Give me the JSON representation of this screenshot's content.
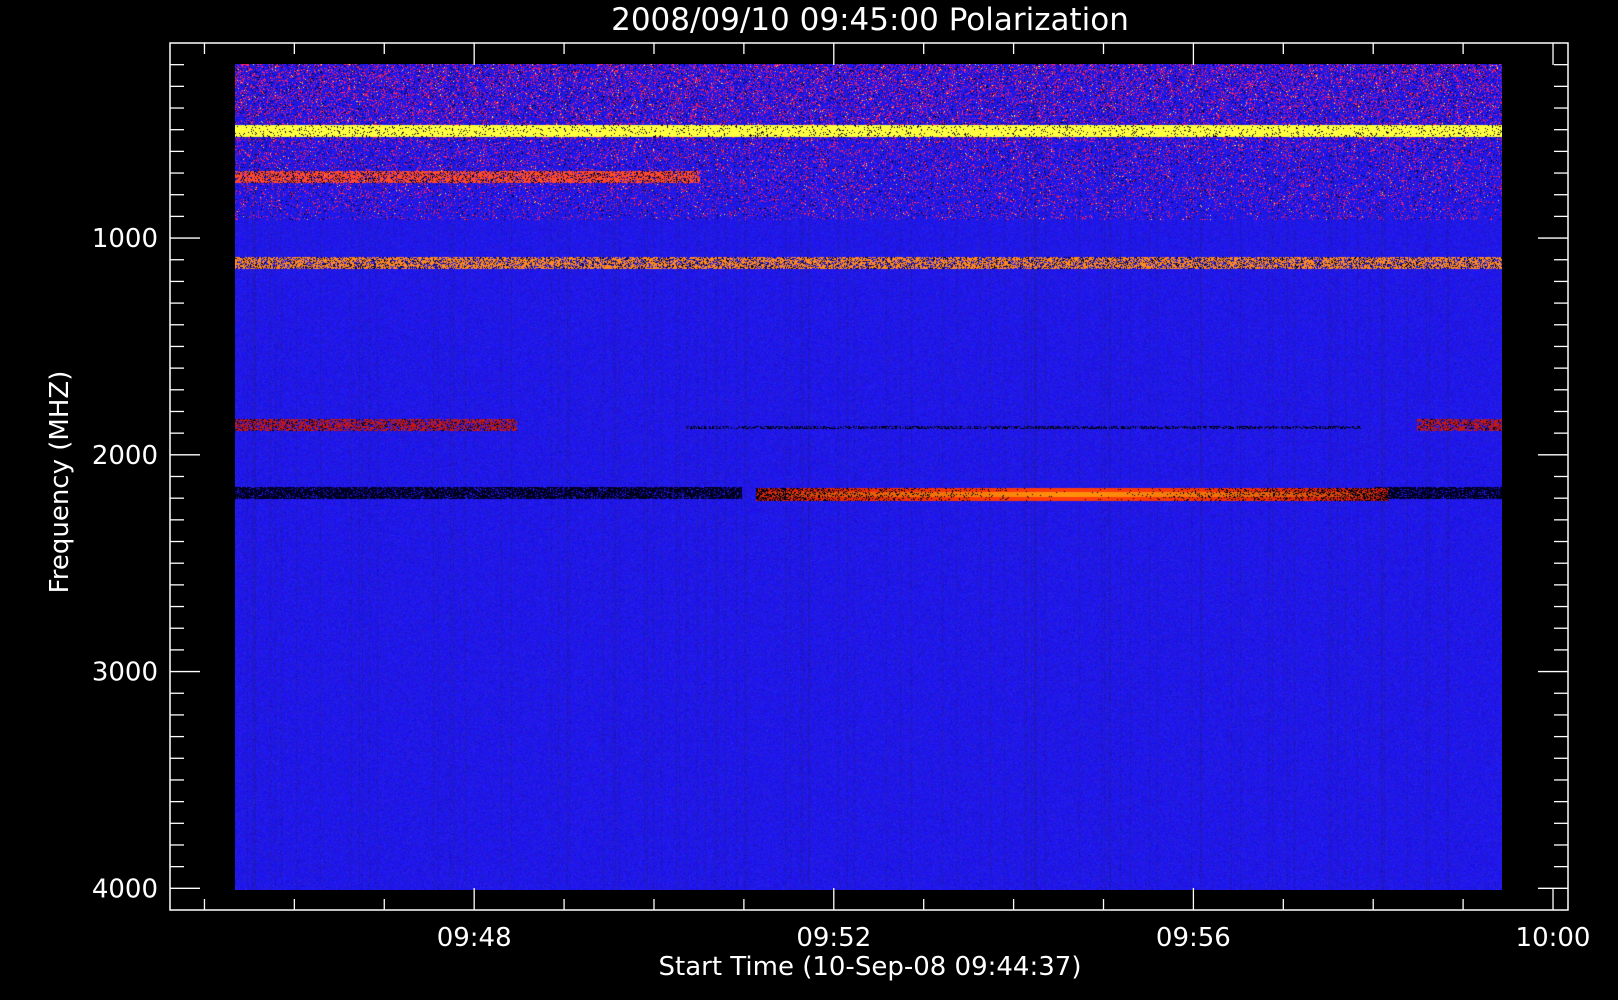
{
  "chart_data": {
    "type": "heatmap",
    "title": "2008/09/10 09:45:00 Polarization",
    "xlabel": "Start Time (10-Sep-08 09:44:37)",
    "ylabel": "Frequency (MHZ)",
    "x_range": [
      "09:44:37",
      "10:00:10"
    ],
    "x_ticks": [
      {
        "time": "09:48",
        "label": "09:48"
      },
      {
        "time": "09:52",
        "label": "09:52"
      },
      {
        "time": "09:56",
        "label": "09:56"
      },
      {
        "time": "10:00",
        "label": "10:00"
      }
    ],
    "x_data_range": [
      "09:45:00",
      "10:00:00"
    ],
    "y_range": [
      100,
      4100
    ],
    "y_inverted": true,
    "y_ticks": [
      {
        "value": 1000,
        "label": "1000"
      },
      {
        "value": 2000,
        "label": "2000"
      },
      {
        "value": 3000,
        "label": "3000"
      },
      {
        "value": 4000,
        "label": "4000"
      }
    ],
    "y_data_range": [
      200,
      4020
    ],
    "background_color": "#000000",
    "colormap": {
      "low": "#000000",
      "mid": "#0000ff",
      "high": "#ff2000",
      "peak": "#ffff60",
      "dominant": "#1a14f0"
    },
    "features": [
      {
        "kind": "noisy-band",
        "freq_from": 200,
        "freq_to": 920,
        "time_from": "09:45:00",
        "time_to": "10:00:00",
        "color": "#ff2a20",
        "intensity": 0.55
      },
      {
        "kind": "line",
        "freq": 510,
        "time_from": "09:45:00",
        "time_to": "10:00:00",
        "color": "#ffff40",
        "intensity": 0.9
      },
      {
        "kind": "line",
        "freq": 722,
        "time_from": "09:45:00",
        "time_to": "09:50:30",
        "color": "#ff4a2a",
        "intensity": 0.7
      },
      {
        "kind": "line",
        "freq": 1120,
        "time_from": "09:45:00",
        "time_to": "10:00:00",
        "color": "#ff8a20",
        "intensity": 0.6
      },
      {
        "kind": "line",
        "freq": 1870,
        "time_from": "09:45:00",
        "time_to": "09:48:20",
        "color": "#c01818",
        "intensity": 0.6
      },
      {
        "kind": "line",
        "freq": 1870,
        "time_from": "09:59:00",
        "time_to": "10:00:00",
        "color": "#c01818",
        "intensity": 0.6
      },
      {
        "kind": "dark-line",
        "freq": 1880,
        "time_from": "09:50:20",
        "time_to": "09:58:20",
        "color": "#000000",
        "intensity": 0.5
      },
      {
        "kind": "dark-band",
        "freq": 2185,
        "time_from": "09:45:00",
        "time_to": "09:51:00",
        "color": "#000010",
        "intensity": 0.8
      },
      {
        "kind": "dark-band",
        "freq": 2185,
        "time_from": "09:58:30",
        "time_to": "10:00:00",
        "color": "#000010",
        "intensity": 0.8
      },
      {
        "kind": "bright-band",
        "freq": 2190,
        "time_from": "09:51:10",
        "time_to": "09:58:40",
        "color": "#ff3010",
        "intensity": 1.0
      }
    ]
  }
}
